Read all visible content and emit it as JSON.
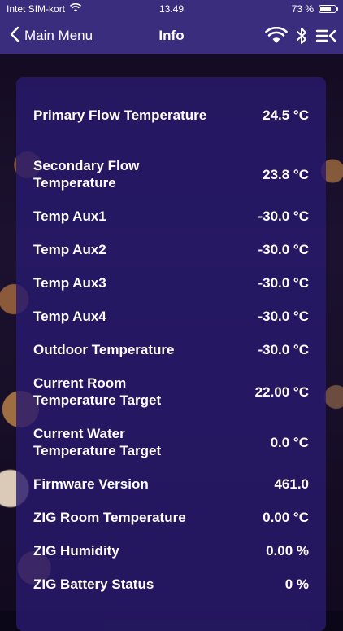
{
  "status_bar": {
    "carrier": "Intet SIM-kort",
    "time": "13.49",
    "battery_text": "73 %",
    "battery_level": 0.73
  },
  "nav": {
    "back_label": "Main Menu",
    "title": "Info",
    "icons": [
      "wifi-icon",
      "bluetooth-icon",
      "menu-icon"
    ]
  },
  "info": {
    "rows": [
      {
        "label": "Primary Flow Temperature",
        "value": "24.5 °C"
      },
      {
        "label": "Secondary Flow Temperature",
        "value": "23.8 °C"
      },
      {
        "label": "Temp Aux1",
        "value": "-30.0 °C"
      },
      {
        "label": "Temp Aux2",
        "value": "-30.0 °C"
      },
      {
        "label": "Temp Aux3",
        "value": "-30.0 °C"
      },
      {
        "label": "Temp Aux4",
        "value": "-30.0 °C"
      },
      {
        "label": "Outdoor Temperature",
        "value": "-30.0 °C"
      },
      {
        "label": "Current Room Temperature Target",
        "value": "22.00 °C"
      },
      {
        "label": "Current Water Temperature Target",
        "value": "0.0 °C"
      },
      {
        "label": "Firmware Version",
        "value": "461.0"
      },
      {
        "label": "ZIG Room Temperature",
        "value": "0.00 °C"
      },
      {
        "label": "ZIG Humidity",
        "value": "0.00 %"
      },
      {
        "label": "ZIG Battery Status",
        "value": "0 %"
      }
    ]
  }
}
